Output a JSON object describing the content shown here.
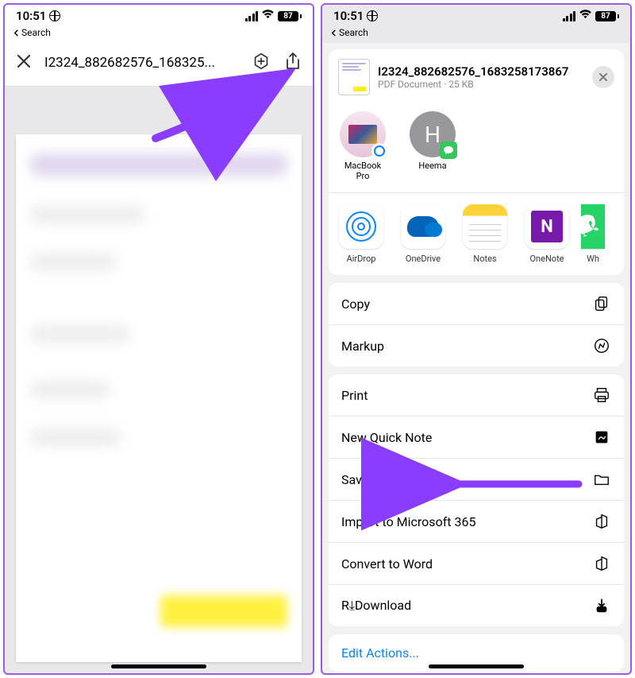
{
  "status": {
    "time": "10:51",
    "battery": "87",
    "back_label": "Search"
  },
  "left": {
    "file_title_truncated": "I2324_882682576_168325..."
  },
  "share": {
    "title": "I2324_882682576_1683258173867",
    "subtitle": "PDF Document · 25 KB",
    "contacts": [
      {
        "label": "MacBook Pro"
      },
      {
        "label": "Heema"
      }
    ],
    "apps": [
      {
        "label": "AirDrop"
      },
      {
        "label": "OneDrive"
      },
      {
        "label": "Notes"
      },
      {
        "label": "OneNote"
      },
      {
        "label_partial": "Wh"
      }
    ],
    "group1": [
      {
        "label": "Copy"
      },
      {
        "label": "Markup"
      }
    ],
    "group2": [
      {
        "label": "Print"
      },
      {
        "label": "New Quick Note"
      },
      {
        "label": "Save to Files"
      },
      {
        "label": "Import to Microsoft 365"
      },
      {
        "label": "Convert to Word"
      },
      {
        "label": "R⤓Download"
      }
    ],
    "edit_actions": "Edit Actions..."
  }
}
